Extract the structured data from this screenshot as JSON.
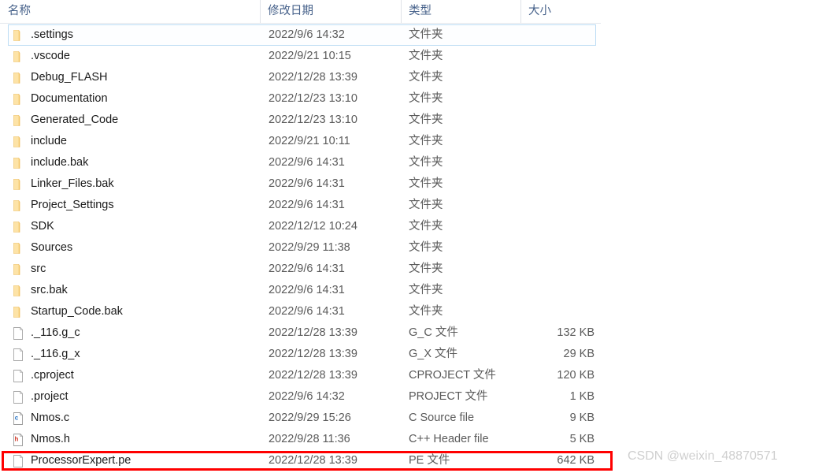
{
  "columns": {
    "name": "名称",
    "date_modified": "修改日期",
    "type": "类型",
    "size": "大小"
  },
  "rows": [
    {
      "icon": "folder-icon",
      "name": ".settings",
      "date": "2022/9/6 14:32",
      "type": "文件夹",
      "size": "",
      "selected": true
    },
    {
      "icon": "folder-icon",
      "name": ".vscode",
      "date": "2022/9/21 10:15",
      "type": "文件夹",
      "size": "",
      "selected": false
    },
    {
      "icon": "folder-icon",
      "name": "Debug_FLASH",
      "date": "2022/12/28 13:39",
      "type": "文件夹",
      "size": "",
      "selected": false
    },
    {
      "icon": "folder-icon",
      "name": "Documentation",
      "date": "2022/12/23 13:10",
      "type": "文件夹",
      "size": "",
      "selected": false
    },
    {
      "icon": "folder-icon",
      "name": "Generated_Code",
      "date": "2022/12/23 13:10",
      "type": "文件夹",
      "size": "",
      "selected": false
    },
    {
      "icon": "folder-icon",
      "name": "include",
      "date": "2022/9/21 10:11",
      "type": "文件夹",
      "size": "",
      "selected": false
    },
    {
      "icon": "folder-icon",
      "name": "include.bak",
      "date": "2022/9/6 14:31",
      "type": "文件夹",
      "size": "",
      "selected": false
    },
    {
      "icon": "folder-icon",
      "name": "Linker_Files.bak",
      "date": "2022/9/6 14:31",
      "type": "文件夹",
      "size": "",
      "selected": false
    },
    {
      "icon": "folder-icon",
      "name": "Project_Settings",
      "date": "2022/9/6 14:31",
      "type": "文件夹",
      "size": "",
      "selected": false
    },
    {
      "icon": "folder-icon",
      "name": "SDK",
      "date": "2022/12/12 10:24",
      "type": "文件夹",
      "size": "",
      "selected": false
    },
    {
      "icon": "folder-icon",
      "name": "Sources",
      "date": "2022/9/29 11:38",
      "type": "文件夹",
      "size": "",
      "selected": false
    },
    {
      "icon": "folder-icon",
      "name": "src",
      "date": "2022/9/6 14:31",
      "type": "文件夹",
      "size": "",
      "selected": false
    },
    {
      "icon": "folder-icon",
      "name": "src.bak",
      "date": "2022/9/6 14:31",
      "type": "文件夹",
      "size": "",
      "selected": false
    },
    {
      "icon": "folder-icon",
      "name": "Startup_Code.bak",
      "date": "2022/9/6 14:31",
      "type": "文件夹",
      "size": "",
      "selected": false
    },
    {
      "icon": "file-icon",
      "name": "._116.g_c",
      "date": "2022/12/28 13:39",
      "type": "G_C 文件",
      "size": "132 KB",
      "selected": false
    },
    {
      "icon": "file-icon",
      "name": "._116.g_x",
      "date": "2022/12/28 13:39",
      "type": "G_X 文件",
      "size": "29 KB",
      "selected": false
    },
    {
      "icon": "file-icon",
      "name": ".cproject",
      "date": "2022/12/28 13:39",
      "type": "CPROJECT 文件",
      "size": "120 KB",
      "selected": false
    },
    {
      "icon": "file-icon",
      "name": ".project",
      "date": "2022/9/6 14:32",
      "type": "PROJECT 文件",
      "size": "1 KB",
      "selected": false
    },
    {
      "icon": "c-source-icon",
      "name": "Nmos.c",
      "date": "2022/9/29 15:26",
      "type": "C Source file",
      "size": "9 KB",
      "selected": false
    },
    {
      "icon": "h-header-icon",
      "name": "Nmos.h",
      "date": "2022/9/28 11:36",
      "type": "C++ Header file",
      "size": "5 KB",
      "selected": false
    },
    {
      "icon": "file-icon",
      "name": "ProcessorExpert.pe",
      "date": "2022/12/28 13:39",
      "type": "PE 文件",
      "size": "642 KB",
      "selected": false
    }
  ],
  "annotation": {
    "highlight_color": "#ff0000",
    "highlighted_row_name": "ProcessorExpert.pe"
  },
  "watermark": {
    "text": "CSDN @weixin_48870571"
  }
}
